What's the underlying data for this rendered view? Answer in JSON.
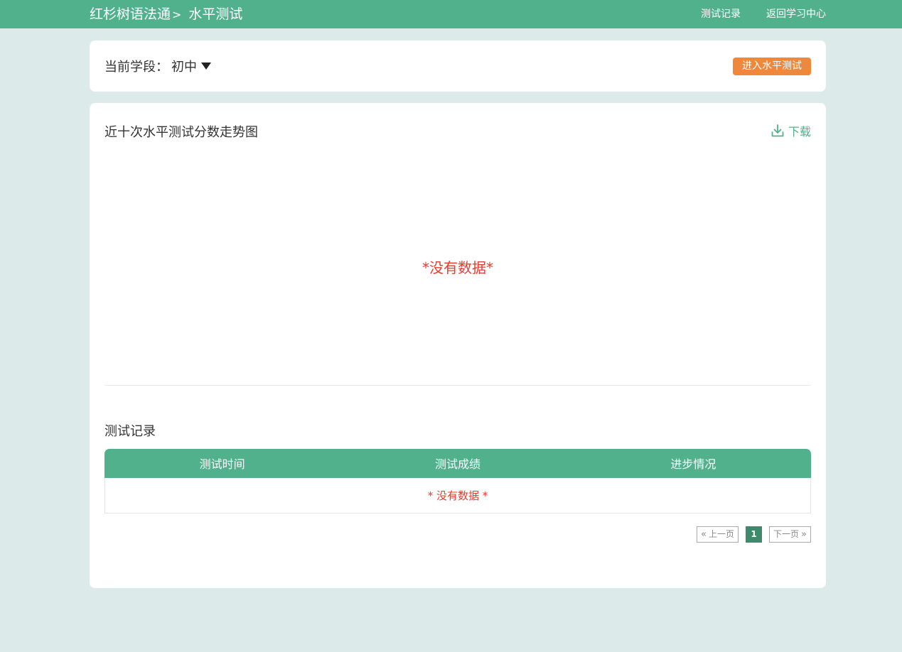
{
  "header": {
    "brand": "红杉树语法通",
    "separator": ">",
    "page_title": "水平测试",
    "nav": [
      "测试记录",
      "返回学习中心"
    ]
  },
  "stage": {
    "label": "当前学段：",
    "value": "初中",
    "enter_button": "进入水平测试"
  },
  "chart_section": {
    "title": "近十次水平测试分数走势图",
    "download_label": "下载",
    "empty_text": "*没有数据*"
  },
  "records": {
    "title": "测试记录",
    "columns": [
      "测试时间",
      "测试成绩",
      "进步情况"
    ],
    "empty_text": "* 没有数据 *"
  },
  "pagination": {
    "prev": "上一页",
    "current": "1",
    "next": "下一页"
  },
  "colors": {
    "primary": "#52b18d",
    "accent": "#f0883b",
    "error": "#e53c2f",
    "background": "#dcebea"
  }
}
